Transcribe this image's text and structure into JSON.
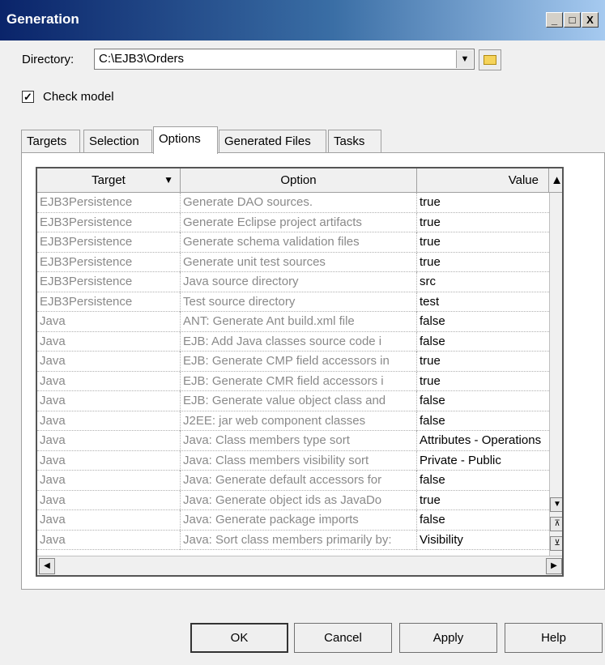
{
  "window": {
    "title": "Generation",
    "controls": [
      "_",
      "□",
      "X"
    ]
  },
  "directory": {
    "label": "Directory:",
    "value": "C:\\EJB3\\Orders",
    "icons": [
      "dropdown-arrow",
      "folder-icon"
    ]
  },
  "check_model": {
    "label": "Check model",
    "checked": true
  },
  "tabs": [
    "Targets",
    "Selection",
    "Options",
    "Generated Files",
    "Tasks"
  ],
  "active_tab": "Options",
  "grid": {
    "columns": [
      "Target",
      "Option",
      "Value"
    ],
    "rows": [
      [
        "EJB3Persistence",
        "Generate DAO sources.",
        "true"
      ],
      [
        "EJB3Persistence",
        "Generate Eclipse project artifacts",
        "true"
      ],
      [
        "EJB3Persistence",
        "Generate schema validation files",
        "true"
      ],
      [
        "EJB3Persistence",
        "Generate unit test sources",
        "true"
      ],
      [
        "EJB3Persistence",
        "Java source directory",
        "src"
      ],
      [
        "EJB3Persistence",
        "Test source directory",
        "test"
      ],
      [
        "Java",
        "ANT: Generate Ant build.xml file",
        "false"
      ],
      [
        "Java",
        "EJB: Add Java classes source code i",
        "false"
      ],
      [
        "Java",
        "EJB: Generate CMP field accessors in",
        "true"
      ],
      [
        "Java",
        "EJB: Generate CMR field accessors i",
        "true"
      ],
      [
        "Java",
        "EJB: Generate value object class and",
        "false"
      ],
      [
        "Java",
        "J2EE: jar web component classes",
        "false"
      ],
      [
        "Java",
        "Java: Class members type sort",
        "Attributes - Operations"
      ],
      [
        "Java",
        "Java: Class members visibility sort",
        "Private - Public"
      ],
      [
        "Java",
        "Java: Generate default accessors for",
        "false"
      ],
      [
        "Java",
        "Java: Generate object ids as JavaDo",
        "true"
      ],
      [
        "Java",
        "Java: Generate package imports",
        "false"
      ],
      [
        "Java",
        "Java: Sort class members primarily by:",
        "Visibility"
      ]
    ]
  },
  "buttons": {
    "ok": "OK",
    "cancel": "Cancel",
    "apply": "Apply",
    "help": "Help"
  }
}
